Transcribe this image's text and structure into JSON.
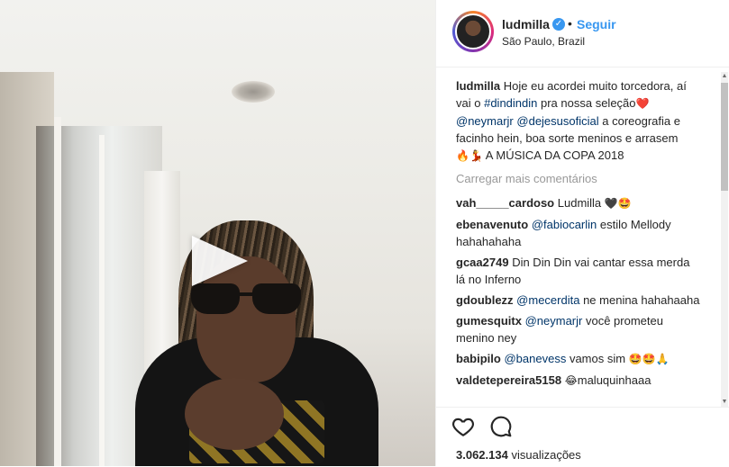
{
  "post": {
    "username": "ludmilla",
    "follow_label": "Seguir",
    "separator": "•",
    "location": "São Paulo, Brazil",
    "caption": {
      "user": "ludmilla",
      "text_1": "Hoje eu acordei muito torcedora, aí vai o",
      "hashtag": "#dindindin",
      "text_2": "pra nossa seleção",
      "heart_emoji": "❤️",
      "mention_1": "@neymarjr",
      "mention_2": "@dejesusoficial",
      "text_3": "a coreografia e facinho hein, boa sorte meninos e arrasem",
      "emojis": "🔥💃",
      "text_4": "A MÚSICA DA COPA 2018"
    },
    "load_more": "Carregar mais comentários",
    "comments": [
      {
        "user": "vah_____cardoso",
        "mention": "",
        "text": "Ludmilla",
        "emoji": "🖤🤩"
      },
      {
        "user": "ebenavenuto",
        "mention": "@fabiocarlin",
        "text": "estilo Mellody hahahahaha",
        "emoji": ""
      },
      {
        "user": "gcaa2749",
        "mention": "",
        "text": "Din Din Din vai cantar essa merda lá no Inferno",
        "emoji": ""
      },
      {
        "user": "gdoublezz",
        "mention": "@mecerdita",
        "text": "ne menina hahahaaha",
        "emoji": ""
      },
      {
        "user": "gumesquitx",
        "mention": "@neymarjr",
        "text": "você prometeu menino ney",
        "emoji": ""
      },
      {
        "user": "babipilo",
        "mention": "@banevess",
        "text": "vamos sim",
        "emoji": "🤩🤩🙏"
      },
      {
        "user": "valdetepereira5158",
        "mention": "",
        "text": "maluquinhaaa",
        "emoji": "😂"
      }
    ],
    "views": "3.062.134",
    "views_label": "visualizações"
  },
  "icons": {
    "play": "play-icon",
    "verified": "verified-badge-icon",
    "like": "heart-icon",
    "comment": "comment-icon"
  },
  "colors": {
    "link": "#3897f0",
    "text": "#262626",
    "muted": "#999999",
    "mention": "#003569"
  }
}
